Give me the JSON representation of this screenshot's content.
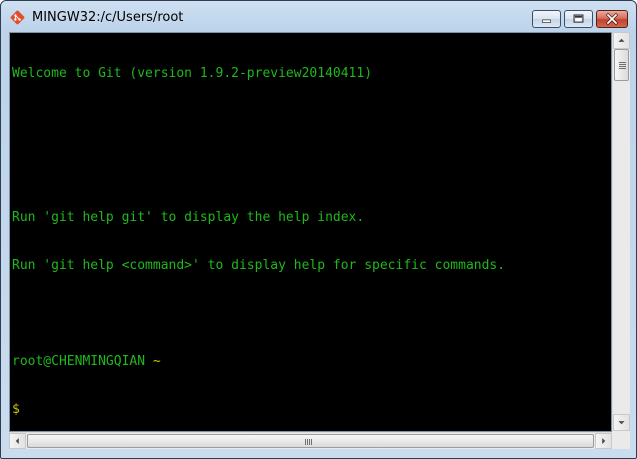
{
  "window": {
    "title": "MINGW32:/c/Users/root",
    "icon": "git-logo-icon",
    "buttons": {
      "minimize": "minimize-icon",
      "maximize": "maximize-icon",
      "close": "close-icon"
    }
  },
  "terminal": {
    "lines": [
      "Welcome to Git (version 1.9.2-preview20140411)",
      "",
      "",
      "Run 'git help git' to display the help index.",
      "Run 'git help <command>' to display help for specific commands.",
      ""
    ],
    "prompt": {
      "user_host": "root@CHENMINGQIAN",
      "path": "~",
      "symbol": "$"
    }
  },
  "colors": {
    "text_green": "#1fb81b",
    "prompt_yellow": "#c8c000",
    "background": "#000000"
  }
}
